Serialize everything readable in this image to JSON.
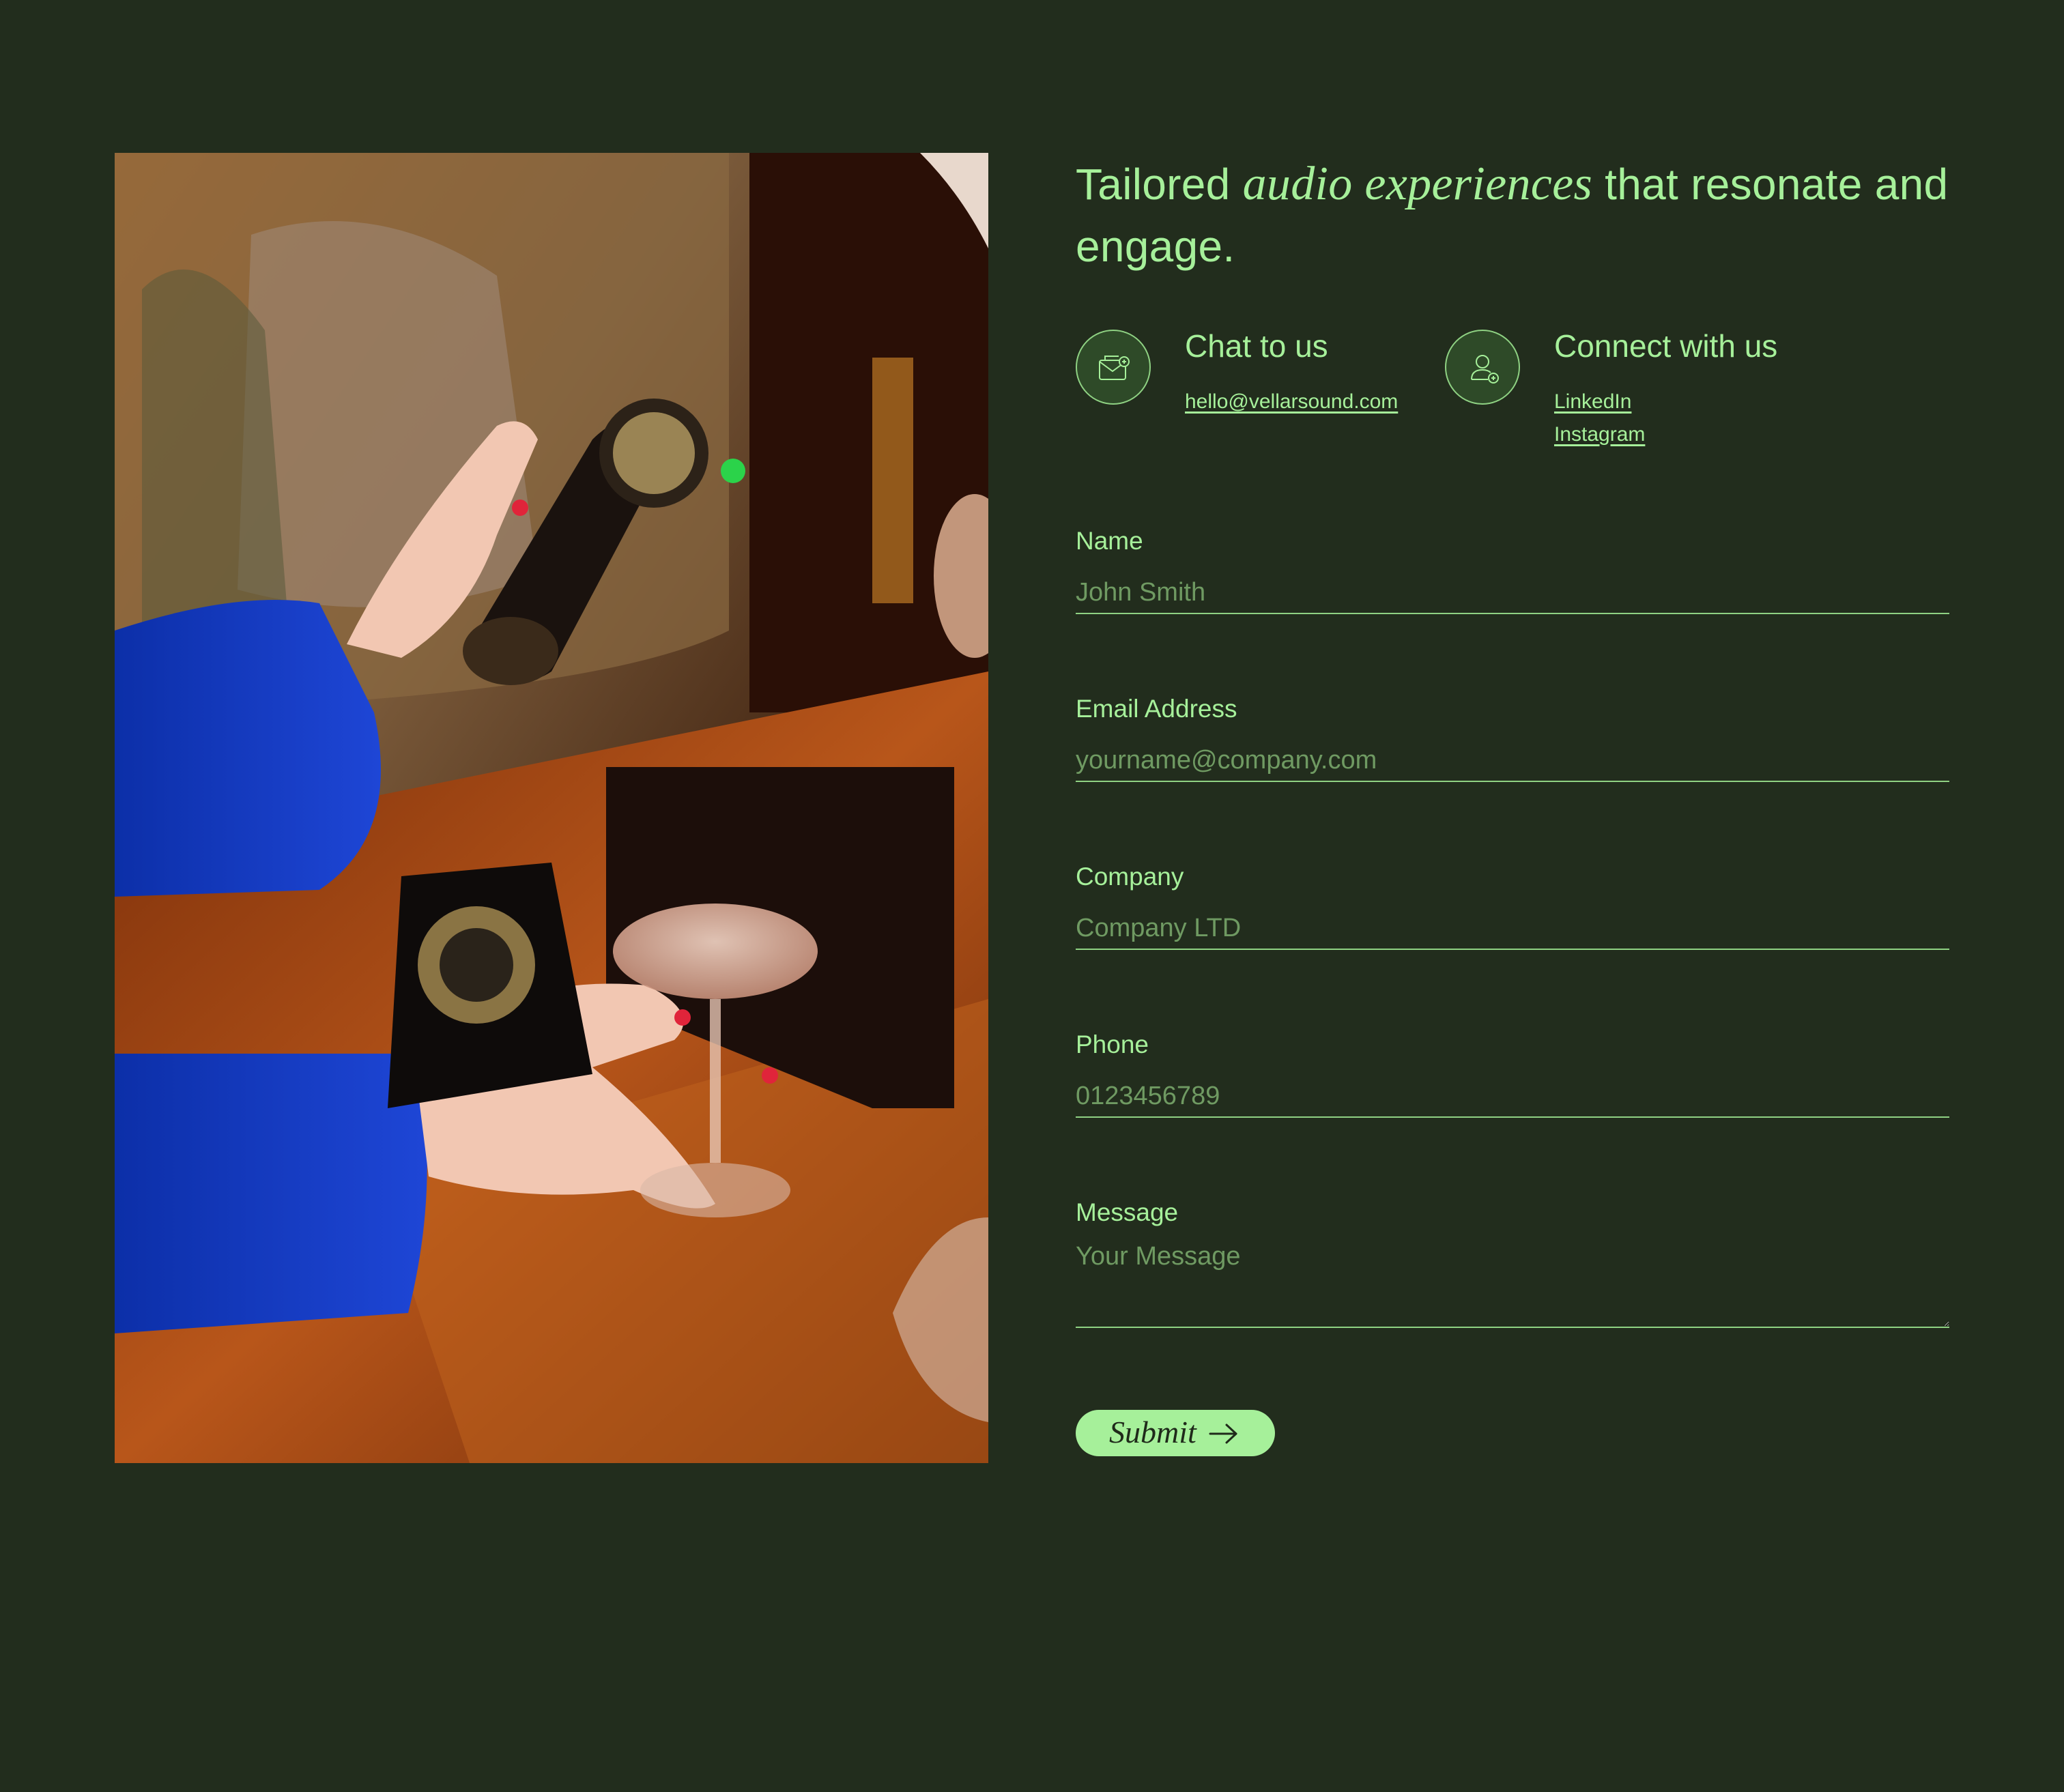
{
  "headline": {
    "before": "Tailored",
    "italic": "audio experiences",
    "after": "that resonate and engage."
  },
  "contacts": [
    {
      "title": "Chat to us",
      "icon": "mail-icon",
      "links": [
        "hello@vellarsound.com"
      ]
    },
    {
      "title": "Connect with us",
      "icon": "user-add-icon",
      "links": [
        "LinkedIn",
        "Instagram"
      ]
    }
  ],
  "form": {
    "fields": [
      {
        "label": "Name",
        "placeholder": "John Smith"
      },
      {
        "label": "Email Address",
        "placeholder": "yourname@company.com"
      },
      {
        "label": "Company",
        "placeholder": "Company LTD"
      },
      {
        "label": "Phone",
        "placeholder": "0123456789"
      },
      {
        "label": "Message",
        "placeholder": "Your Message"
      }
    ],
    "submit_label": "Submit",
    "submit_icon": "arrow-right-icon"
  },
  "colors": {
    "background": "#222d1d",
    "accent": "#a6f09a",
    "button_text": "#1f2a1a",
    "placeholder": "#6f9a62"
  }
}
